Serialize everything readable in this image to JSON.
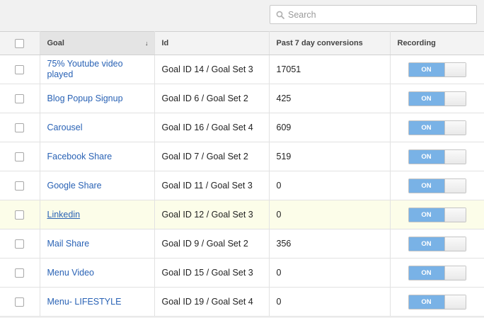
{
  "search": {
    "placeholder": "Search",
    "value": ""
  },
  "table": {
    "headers": {
      "goal": "Goal",
      "id": "Id",
      "conversions": "Past 7 day conversions",
      "recording": "Recording"
    },
    "rows": [
      {
        "goal": "75% Youtube video played",
        "id": "Goal ID 14 / Goal Set 3",
        "conversions": "17051",
        "recording": "ON"
      },
      {
        "goal": "Blog Popup Signup",
        "id": "Goal ID 6 / Goal Set 2",
        "conversions": "425",
        "recording": "ON"
      },
      {
        "goal": "Carousel",
        "id": "Goal ID 16 / Goal Set 4",
        "conversions": "609",
        "recording": "ON"
      },
      {
        "goal": "Facebook Share",
        "id": "Goal ID 7 / Goal Set 2",
        "conversions": "519",
        "recording": "ON"
      },
      {
        "goal": "Google Share",
        "id": "Goal ID 11 / Goal Set 3",
        "conversions": "0",
        "recording": "ON"
      },
      {
        "goal": "Linkedin",
        "id": "Goal ID 12 / Goal Set 3",
        "conversions": "0",
        "recording": "ON"
      },
      {
        "goal": "Mail Share",
        "id": "Goal ID 9 / Goal Set 2",
        "conversions": "356",
        "recording": "ON"
      },
      {
        "goal": "Menu Video",
        "id": "Goal ID 15 / Goal Set 3",
        "conversions": "0",
        "recording": "ON"
      },
      {
        "goal": "Menu- LIFESTYLE",
        "id": "Goal ID 19 / Goal Set 4",
        "conversions": "0",
        "recording": "ON"
      }
    ]
  },
  "colors": {
    "link": "#2962b5",
    "toggle_on": "#79b2e6",
    "highlight_row": "#fcfde9"
  },
  "icons": {
    "search": "search-icon",
    "sort": "sort-down-arrow-icon"
  }
}
